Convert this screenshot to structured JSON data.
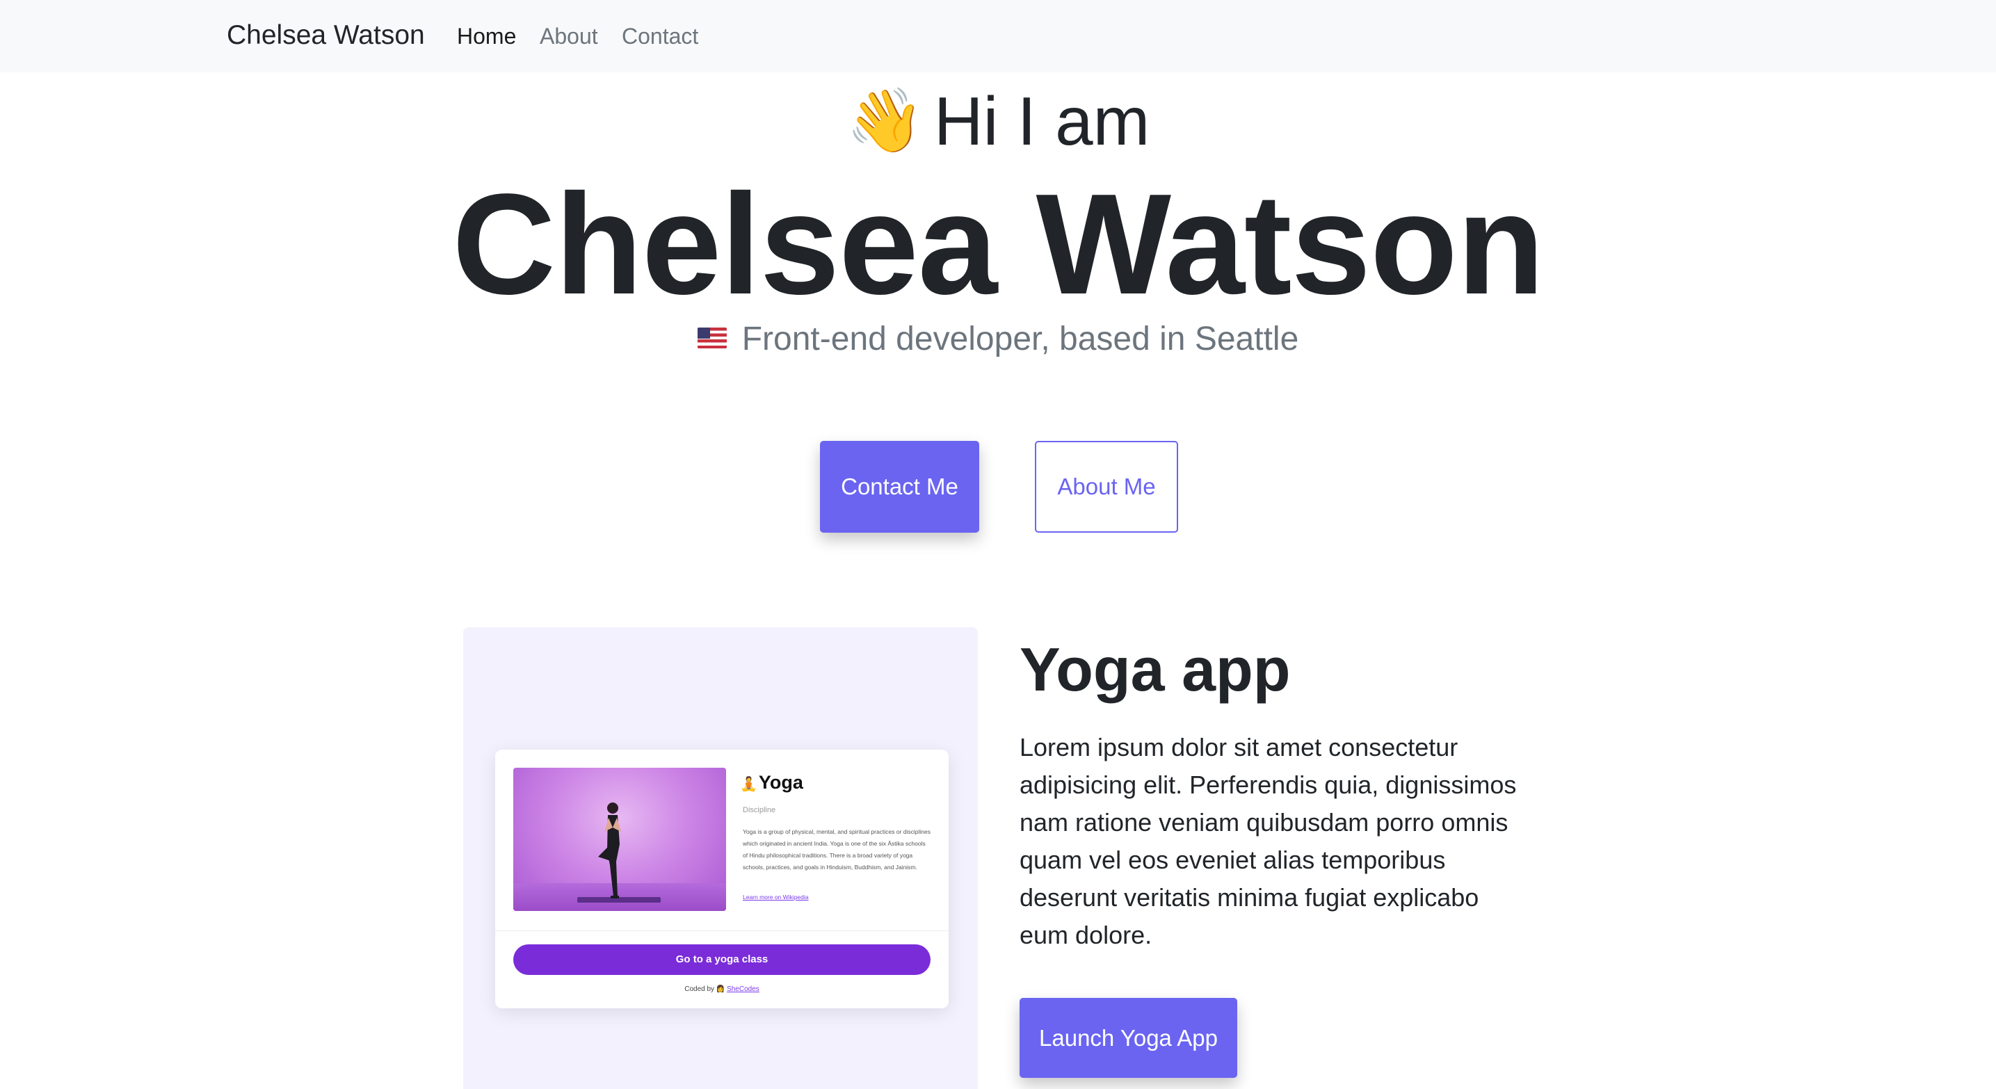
{
  "nav": {
    "brand": "Chelsea Watson",
    "links": [
      {
        "label": "Home",
        "active": true
      },
      {
        "label": "About",
        "active": false
      },
      {
        "label": "Contact",
        "active": false
      }
    ]
  },
  "hero": {
    "wave_emoji": "👋",
    "greeting": "Hi I am",
    "name": "Chelsea Watson",
    "flag_icon": "us-flag-icon",
    "tagline": "Front-end developer, based in Seattle",
    "contact_button": "Contact Me",
    "about_button": "About Me"
  },
  "project": {
    "title": "Yoga app",
    "description": "Lorem ipsum dolor sit amet consectetur adipisicing elit. Perferendis quia, dignissimos nam ratione veniam quibusdam porro omnis quam vel eos eveniet alias temporibus deserunt veritatis minima fugiat explicabo eum dolore.",
    "launch_button": "Launch Yoga App",
    "preview": {
      "emoji": "🧘",
      "title": "Yoga",
      "subtitle": "Discipline",
      "body": "Yoga is a group of physical, mental, and spiritual practices or disciplines which originated in ancient India. Yoga is one of the six Āstika schools of Hindu philosophical traditions. There is a broad variety of yoga schools, practices, and goals in Hinduism, Buddhism, and Jainism.",
      "link": "Learn more on Wikipedia",
      "button": "Go to a yoga class",
      "footer_prefix": "Coded by",
      "footer_emoji": "👩",
      "footer_link": "SheCodes"
    }
  },
  "colors": {
    "accent": "#6a64f1",
    "navbar_bg": "#f8f9fa",
    "text": "#212529",
    "muted": "#6c757d",
    "preview_bg": "#f3f1fd",
    "preview_button": "#7b2cd9"
  }
}
